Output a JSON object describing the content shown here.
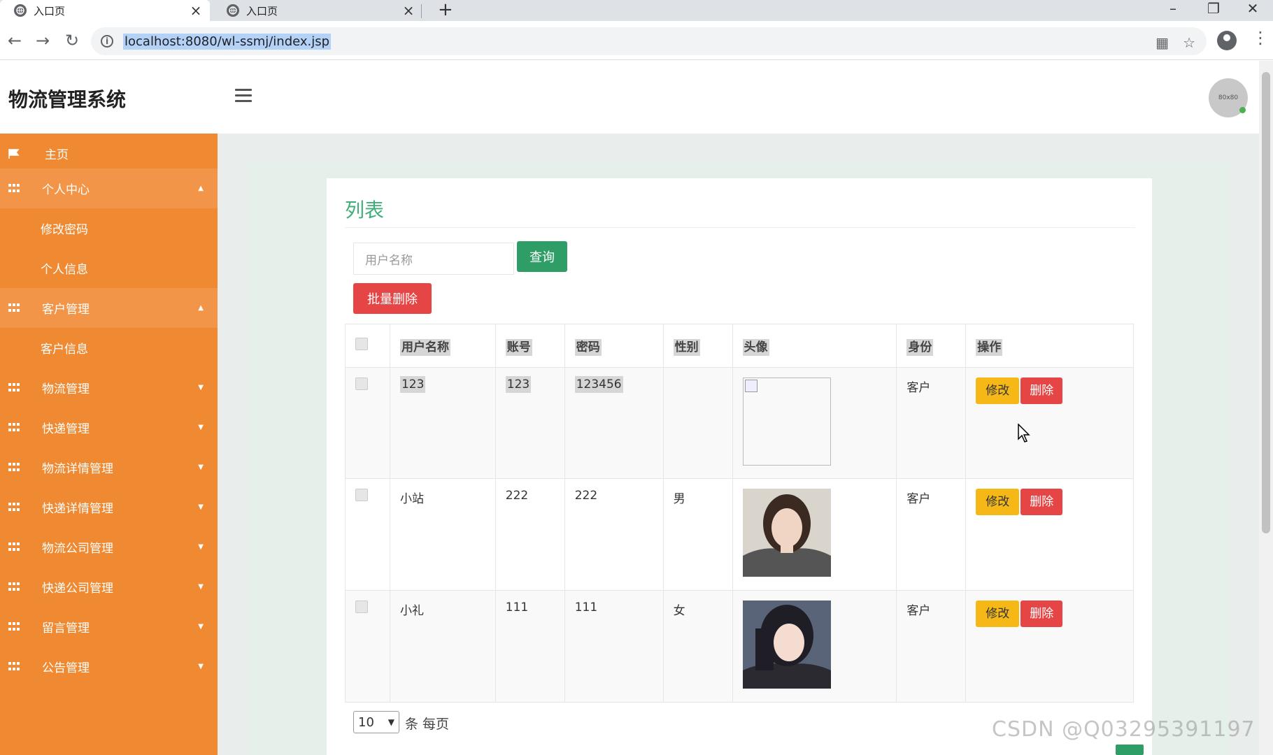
{
  "browser": {
    "tabs": [
      {
        "title": "入口页",
        "close": "×"
      },
      {
        "title": "入口页",
        "close": "×"
      }
    ],
    "new_tab": "+",
    "url": "localhost:8080/wl-ssmj/index.jsp",
    "window_controls": {
      "minimize": "–",
      "restore": "❐",
      "close": "✕"
    },
    "nav": {
      "back": "←",
      "forward": "→",
      "reload": "↻"
    }
  },
  "app": {
    "brand": "物流管理系统",
    "avatar_label": "80x80"
  },
  "sidebar": {
    "items": [
      {
        "label": "主页",
        "icon": "flag-icon"
      },
      {
        "label": "个人中心",
        "icon": "grid-icon",
        "open": true,
        "caret": "▲"
      },
      {
        "label": "修改密码",
        "sub": true
      },
      {
        "label": "个人信息",
        "sub": true
      },
      {
        "label": "客户管理",
        "icon": "grid-icon",
        "open": true,
        "caret": "▲"
      },
      {
        "label": "客户信息",
        "sub": true
      },
      {
        "label": "物流管理",
        "icon": "grid-icon",
        "caret": "▼"
      },
      {
        "label": "快递管理",
        "icon": "grid-icon",
        "caret": "▼"
      },
      {
        "label": "物流详情管理",
        "icon": "grid-icon",
        "caret": "▼"
      },
      {
        "label": "快递详情管理",
        "icon": "grid-icon",
        "caret": "▼"
      },
      {
        "label": "物流公司管理",
        "icon": "grid-icon",
        "caret": "▼"
      },
      {
        "label": "快递公司管理",
        "icon": "grid-icon",
        "caret": "▼"
      },
      {
        "label": "留言管理",
        "icon": "grid-icon",
        "caret": "▼"
      },
      {
        "label": "公告管理",
        "icon": "grid-icon",
        "caret": "▼"
      }
    ]
  },
  "main": {
    "title": "列表",
    "search": {
      "placeholder": "用户名称",
      "button": "查询"
    },
    "batch_delete": "批量删除",
    "table": {
      "headers": [
        "用户名称",
        "账号",
        "密码",
        "性别",
        "头像",
        "身份",
        "操作"
      ],
      "rows": [
        {
          "name": "123",
          "account": "123",
          "password": "123456",
          "gender": "",
          "role": "客户",
          "photo": "broken"
        },
        {
          "name": "小站",
          "account": "222",
          "password": "222",
          "gender": "男",
          "role": "客户",
          "photo": "woman-1"
        },
        {
          "name": "小礼",
          "account": "111",
          "password": "111",
          "gender": "女",
          "role": "客户",
          "photo": "woman-2"
        }
      ],
      "edit_label": "修改",
      "delete_label": "删除"
    },
    "pager": {
      "page_size": "10",
      "label": "条 每页"
    }
  },
  "watermark": "CSDN @Q03295391197",
  "colors": {
    "sidebar": "#ef8a32",
    "primary": "#2e9e66",
    "danger": "#e64545",
    "warning": "#f5b817",
    "title": "#3fae79"
  }
}
